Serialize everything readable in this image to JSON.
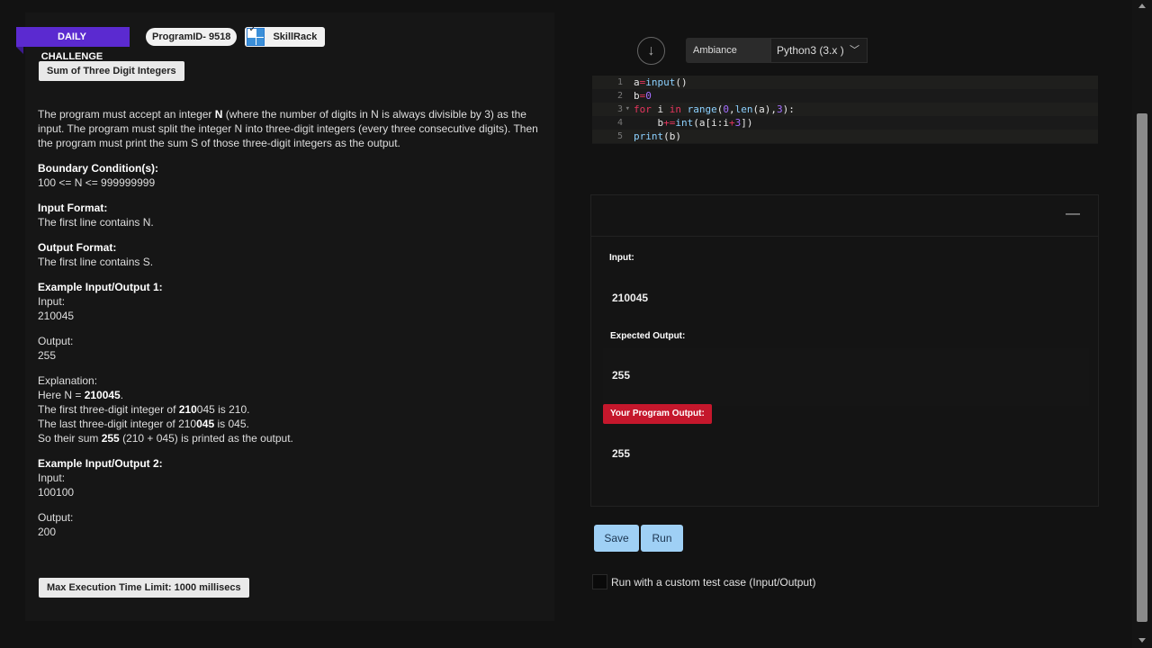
{
  "header": {
    "daily_challenge": "DAILY CHALLENGE",
    "program_id": "ProgramID- 9518",
    "skillrack": "SkillRack"
  },
  "problem": {
    "title": "Sum of Three Digit Integers",
    "desc_1": "The program must accept an integer ",
    "desc_n": "N",
    "desc_2": " (where the number of digits in N is always divisible by 3) as the input. The program must split the integer N into three-digit integers (every three consecutive digits). Then the program must print the sum S of those three-digit integers as the output.",
    "boundary_heading": "Boundary Condition(s):",
    "boundary": "100 <= N <= 999999999",
    "input_heading": "Input Format:",
    "input_format": "The first line contains N.",
    "output_heading": "Output Format:",
    "output_format": "The first line contains S.",
    "ex1_heading": "Example Input/Output 1:",
    "ex1_input_label": "Input:",
    "ex1_input": "210045",
    "ex1_output_label": "Output:",
    "ex1_output": "255",
    "explanation_label": "Explanation:",
    "exp_1a": "Here N = ",
    "exp_1b": "210045",
    "exp_1c": ".",
    "exp_2a": "The first three-digit integer of ",
    "exp_2b": "210",
    "exp_2c": "045 is 210.",
    "exp_3a": "The last three-digit integer of 210",
    "exp_3b": "045",
    "exp_3c": " is 045.",
    "exp_4a": "So their sum ",
    "exp_4b": "255",
    "exp_4c": " (210 + 045) is printed as the output.",
    "ex2_heading": "Example Input/Output 2:",
    "ex2_input_label": "Input:",
    "ex2_input": "100100",
    "ex2_output_label": "Output:",
    "ex2_output": "200",
    "time_limit": "Max Execution Time Limit: 1000 millisecs"
  },
  "toolbar": {
    "ambiance": "Ambiance",
    "language": "Python3 (3.x )"
  },
  "editor": {
    "line_numbers": [
      "1",
      "2",
      "3",
      "4",
      "5"
    ],
    "line1_var": "a",
    "line1_op": "=",
    "line1_fn": "input",
    "line1_rest": "()",
    "line2_var": "b",
    "line2_op": "=",
    "line2_num": "0",
    "line3_for": "for",
    "line3_i": " i ",
    "line3_in": "in",
    "line3_sp": " ",
    "line3_range": "range",
    "line3_open": "(",
    "line3_zero": "0",
    "line3_comma": ",",
    "line3_len": "len",
    "line3_mid": "(a),",
    "line3_three": "3",
    "line3_end": "):",
    "line4_indent": "    b",
    "line4_op": "+=",
    "line4_int": "int",
    "line4_mid": "(a[i:i",
    "line4_plus": "+",
    "line4_three": "3",
    "line4_end": "])",
    "line5_print": "print",
    "line5_rest": "(b)"
  },
  "output": {
    "input_label": "Input:",
    "input_value": "210045",
    "expected_label": "Expected Output:",
    "expected_value": "255",
    "program_label": "Your Program Output:",
    "program_value": "255"
  },
  "actions": {
    "save": "Save",
    "run": "Run",
    "custom_test": "Run with a custom test case (Input/Output)"
  },
  "colors": {
    "daily_badge": "#5b2ad0",
    "program_output_badge": "#c5172c",
    "button": "#9fd0f5"
  }
}
